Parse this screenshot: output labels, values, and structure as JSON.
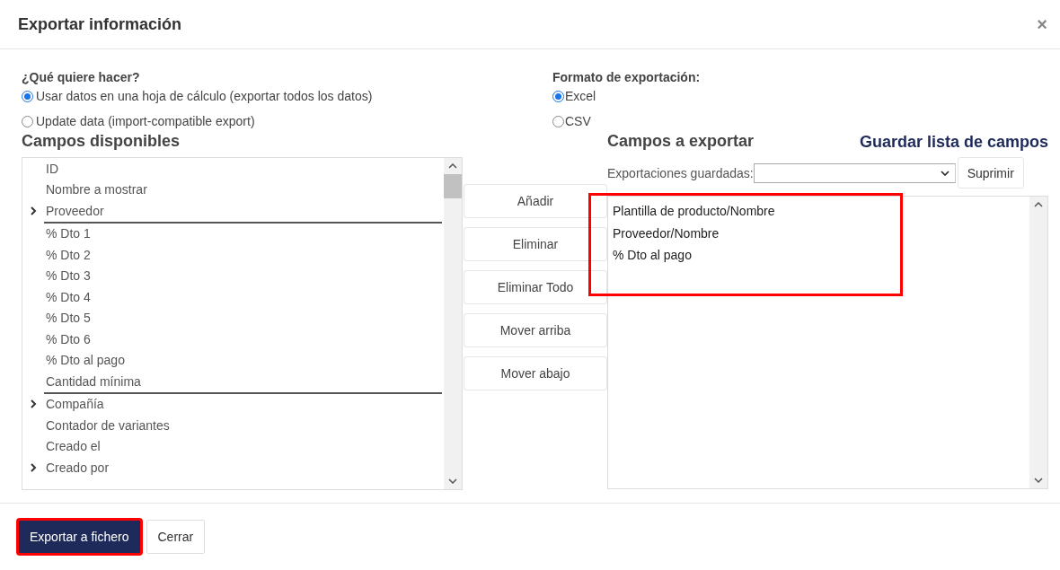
{
  "dialog": {
    "title": "Exportar información",
    "close_icon": "×"
  },
  "export_mode": {
    "label": "¿Qué quiere hacer?",
    "options": [
      {
        "label": "Usar datos en una hoja de cálculo (exportar todos los datos)",
        "selected": true
      },
      {
        "label": "Update data (import-compatible export)",
        "selected": false
      }
    ]
  },
  "export_format": {
    "label": "Formato de exportación:",
    "options": [
      {
        "label": "Excel",
        "selected": true
      },
      {
        "label": "CSV",
        "selected": false
      }
    ]
  },
  "available_fields": {
    "heading": "Campos disponibles",
    "items": [
      {
        "label": "ID",
        "kind": "field"
      },
      {
        "label": "Nombre a mostrar",
        "kind": "field"
      },
      {
        "label": "Proveedor",
        "kind": "relation",
        "children": [
          {
            "label": "% Dto 1",
            "kind": "field"
          },
          {
            "label": "% Dto 2",
            "kind": "field"
          },
          {
            "label": "% Dto 3",
            "kind": "field"
          },
          {
            "label": "% Dto 4",
            "kind": "field"
          },
          {
            "label": "% Dto 5",
            "kind": "field"
          },
          {
            "label": "% Dto 6",
            "kind": "field"
          },
          {
            "label": "% Dto al pago",
            "kind": "field"
          },
          {
            "label": "Cantidad mínima",
            "kind": "field"
          }
        ]
      },
      {
        "label": "Compañía",
        "kind": "relation"
      },
      {
        "label": "Contador de variantes",
        "kind": "field"
      },
      {
        "label": "Creado el",
        "kind": "field"
      },
      {
        "label": "Creado por",
        "kind": "relation"
      }
    ]
  },
  "actions": [
    "Añadir",
    "Eliminar",
    "Eliminar Todo",
    "Mover arriba",
    "Mover abajo"
  ],
  "export_fields": {
    "heading": "Campos a exportar",
    "save_link": "Guardar lista de campos",
    "saved_label": "Exportaciones guardadas:",
    "delete_button": "Suprimir",
    "highlighted": true,
    "items": [
      "Plantilla de producto/Nombre",
      "Proveedor/Nombre",
      "% Dto al pago"
    ]
  },
  "footer": {
    "buttons": [
      {
        "label": "Exportar a fichero",
        "kind": "primary",
        "highlighted": true
      },
      {
        "label": "Cerrar",
        "kind": "secondary",
        "highlighted": false
      }
    ]
  }
}
